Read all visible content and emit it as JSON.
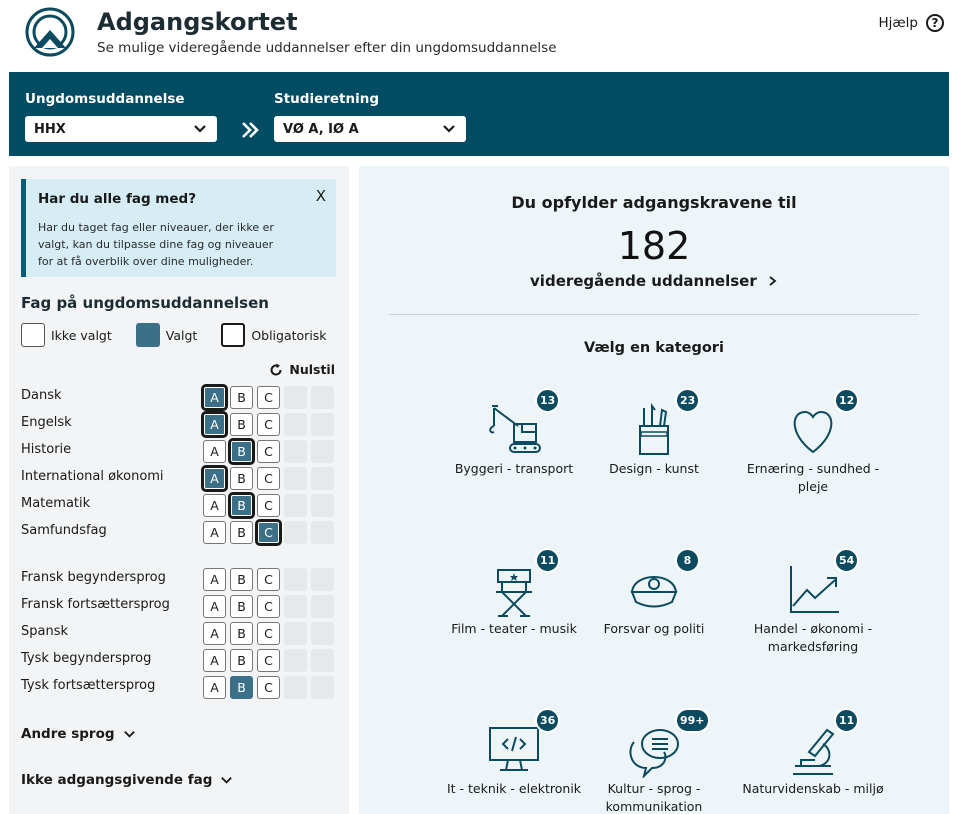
{
  "header": {
    "title": "Adgangskortet",
    "subtitle": "Se mulige videregående uddannelser efter din ungdomsuddannelse",
    "help_label": "Hjælp",
    "help_icon": "?"
  },
  "selectors": {
    "education_label": "Ungdomsuddannelse",
    "education_value": "HHX",
    "direction_label": "Studieretning",
    "direction_value": "VØ A, IØ A"
  },
  "notice": {
    "title": "Har du alle fag med?",
    "close": "X",
    "text": "Har du taget fag eller niveauer, der ikke er valgt, kan du tilpasse dine fag og niveauer for at få overblik over dine muligheder."
  },
  "subjects_panel": {
    "title": "Fag på ungdomsuddannelsen",
    "legend": {
      "not_selected": "Ikke valgt",
      "selected": "Valgt",
      "mandatory": "Obligatorisk"
    },
    "reset_label": "Nulstil",
    "rows": [
      {
        "name": "Dansk",
        "A": "req",
        "B": "off",
        "C": "off"
      },
      {
        "name": "Engelsk",
        "A": "req",
        "B": "off",
        "C": "off"
      },
      {
        "name": "Historie",
        "A": "off",
        "B": "req",
        "C": "off"
      },
      {
        "name": "International økonomi",
        "A": "req",
        "B": "off",
        "C": "off"
      },
      {
        "name": "Matematik",
        "A": "off",
        "B": "req",
        "C": "off"
      },
      {
        "name": "Samfundsfag",
        "A": "off",
        "B": "off",
        "C": "req"
      },
      {
        "name": "Fransk begyndersprog",
        "A": "off",
        "B": "off",
        "C": "off"
      },
      {
        "name": "Fransk fortsættersprog",
        "A": "off",
        "B": "off",
        "C": "off"
      },
      {
        "name": "Spansk",
        "A": "off",
        "B": "off",
        "C": "off"
      },
      {
        "name": "Tysk begyndersprog",
        "A": "off",
        "B": "off",
        "C": "off"
      },
      {
        "name": "Tysk fortsættersprog",
        "A": "off",
        "B": "on",
        "C": "off"
      }
    ],
    "other_languages": "Andre sprog",
    "non_qualifying": "Ikke adgangsgivende fag"
  },
  "results": {
    "heading": "Du opfylder adgangskravene til",
    "count": "182",
    "link": "videregående uddannelser",
    "category_heading": "Vælg en kategori",
    "categories": [
      {
        "label": "Byggeri - transport",
        "count": "13",
        "icon": "crane-icon"
      },
      {
        "label": "Design - kunst",
        "count": "23",
        "icon": "pencil-cup-icon"
      },
      {
        "label": "Ernæring - sundhed - pleje",
        "count": "12",
        "icon": "heart-icon"
      },
      {
        "label": "Film - teater - musik",
        "count": "11",
        "icon": "directors-chair-icon"
      },
      {
        "label": "Forsvar og politi",
        "count": "8",
        "icon": "police-cap-icon"
      },
      {
        "label": "Handel - økonomi - markedsføring",
        "count": "54",
        "icon": "trend-chart-icon"
      },
      {
        "label": "It - teknik - elektronik",
        "count": "36",
        "icon": "monitor-code-icon"
      },
      {
        "label": "Kultur - sprog - kommunikation",
        "count": "99+",
        "icon": "speech-bubbles-icon"
      },
      {
        "label": "Naturvidenskab - miljø",
        "count": "11",
        "icon": "microscope-icon"
      }
    ]
  }
}
